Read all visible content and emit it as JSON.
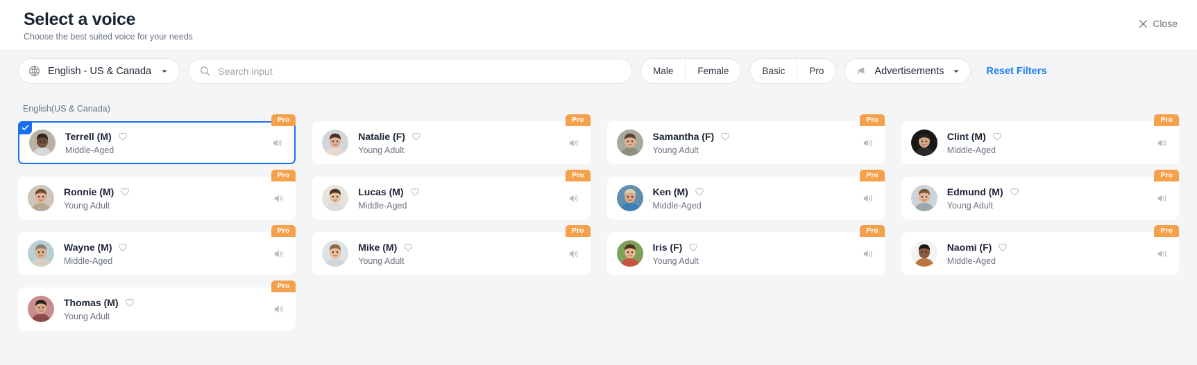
{
  "header": {
    "title": "Select a voice",
    "subtitle": "Choose the best suited voice for your needs",
    "close_label": "Close"
  },
  "filters": {
    "language": {
      "value": "English - US & Canada",
      "icon": "globe-icon"
    },
    "search": {
      "value": "",
      "placeholder": "Search input",
      "icon": "search-icon"
    },
    "gender": {
      "options": [
        "Male",
        "Female"
      ]
    },
    "tier": {
      "options": [
        "Basic",
        "Pro"
      ]
    },
    "usecase": {
      "value": "Advertisements",
      "icon": "ad-icon"
    },
    "reset_label": "Reset Filters"
  },
  "section": {
    "label": "English(US & Canada)"
  },
  "accent": {
    "selected_border": "#1a6ef0",
    "pro_badge": "#f5a04a",
    "link": "#1a7cf5"
  },
  "voices": [
    {
      "name": "Terrell (M)",
      "age": "Middle-Aged",
      "badge": "Pro",
      "selected": true,
      "avatar": {
        "skin": "#6b4a38",
        "hair": "#2e2420",
        "bg": "#b9b2a4",
        "shirt": "#d8d8d8"
      }
    },
    {
      "name": "Natalie (F)",
      "age": "Young Adult",
      "badge": "Pro",
      "selected": false,
      "avatar": {
        "skin": "#e0b293",
        "hair": "#4a2e20",
        "bg": "#d3d5da",
        "shirt": "#e7d9cd"
      }
    },
    {
      "name": "Samantha (F)",
      "age": "Young Adult",
      "badge": "Pro",
      "selected": false,
      "avatar": {
        "skin": "#dfb295",
        "hair": "#5d4030",
        "bg": "#a9a89c",
        "shirt": "#8d8f7e"
      }
    },
    {
      "name": "Clint (M)",
      "age": "Middle-Aged",
      "badge": "Pro",
      "selected": false,
      "avatar": {
        "skin": "#d6a487",
        "hair": "#23201e",
        "bg": "#181818",
        "shirt": "#2a2a2a"
      }
    },
    {
      "name": "Ronnie (M)",
      "age": "Young Adult",
      "badge": "Pro",
      "selected": false,
      "avatar": {
        "skin": "#e3b193",
        "hair": "#6b4a30",
        "bg": "#cfc6bb",
        "shirt": "#b9a795"
      }
    },
    {
      "name": "Lucas (M)",
      "age": "Middle-Aged",
      "badge": "Pro",
      "selected": false,
      "avatar": {
        "skin": "#e7c0a0",
        "hair": "#4b3324",
        "bg": "#e6e4df",
        "shirt": "#dcdcdc"
      }
    },
    {
      "name": "Ken (M)",
      "age": "Middle-Aged",
      "badge": "Pro",
      "selected": false,
      "avatar": {
        "skin": "#d9a887",
        "hair": "#d9cdb4",
        "bg": "#5f8fae",
        "shirt": "#3a7fb5"
      }
    },
    {
      "name": "Edmund (M)",
      "age": "Young Adult",
      "badge": "Pro",
      "selected": false,
      "avatar": {
        "skin": "#e3b795",
        "hair": "#7a5636",
        "bg": "#cdd3d7",
        "shirt": "#9aa7ad"
      }
    },
    {
      "name": "Wayne (M)",
      "age": "Middle-Aged",
      "badge": "Pro",
      "selected": false,
      "avatar": {
        "skin": "#dcae8c",
        "hair": "#8c8378",
        "bg": "#b9cfd2",
        "shirt": "#d8cfc4"
      }
    },
    {
      "name": "Mike (M)",
      "age": "Young Adult",
      "badge": "Pro",
      "selected": false,
      "avatar": {
        "skin": "#e8bc9a",
        "hair": "#8a6a45",
        "bg": "#dfe2e4",
        "shirt": "#cfd5d8"
      }
    },
    {
      "name": "Iris (F)",
      "age": "Young Adult",
      "badge": "Pro",
      "selected": false,
      "avatar": {
        "skin": "#e6b692",
        "hair": "#4a3322",
        "bg": "#7ea05a",
        "shirt": "#c7543f"
      }
    },
    {
      "name": "Naomi (F)",
      "age": "Middle-Aged",
      "badge": "Pro",
      "selected": false,
      "avatar": {
        "skin": "#8a5a3f",
        "hair": "#1c1715",
        "bg": "#f2f2f2",
        "shirt": "#b9763f"
      }
    },
    {
      "name": "Thomas (M)",
      "age": "Young Adult",
      "badge": "Pro",
      "selected": false,
      "avatar": {
        "skin": "#dba98a",
        "hair": "#2b2320",
        "bg": "#c98d8d",
        "shirt": "#8d4a4a"
      }
    }
  ]
}
